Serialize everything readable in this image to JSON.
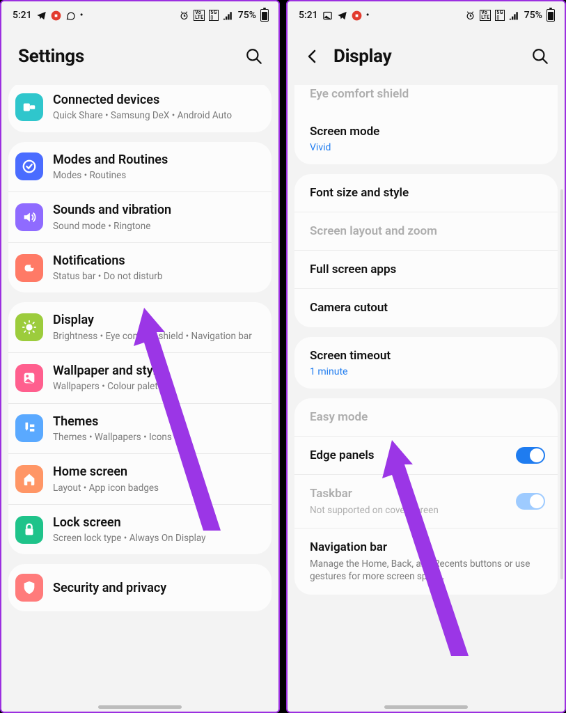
{
  "status": {
    "time": "5:21",
    "battery": "75%"
  },
  "left": {
    "title": "Settings",
    "items": [
      {
        "icon": "connected",
        "color": "#2fc6cc",
        "title": "Connected devices",
        "sub": "Quick Share  •  Samsung DeX  •  Android Auto"
      },
      {
        "icon": "modes",
        "color": "#4a6cff",
        "title": "Modes and Routines",
        "sub": "Modes  •  Routines"
      },
      {
        "icon": "sound",
        "color": "#8f6bff",
        "title": "Sounds and vibration",
        "sub": "Sound mode  •  Ringtone"
      },
      {
        "icon": "notif",
        "color": "#ff7a66",
        "title": "Notifications",
        "sub": "Status bar  •  Do not disturb"
      },
      {
        "icon": "display",
        "color": "#9ccc3c",
        "title": "Display",
        "sub": "Brightness  •  Eye comfort shield  •  Navigation bar"
      },
      {
        "icon": "wall",
        "color": "#ff5f8e",
        "title": "Wallpaper and style",
        "sub": "Wallpapers  •  Colour palette"
      },
      {
        "icon": "themes",
        "color": "#5aa9ff",
        "title": "Themes",
        "sub": "Themes  •  Wallpapers  •  Icons"
      },
      {
        "icon": "home",
        "color": "#ff9666",
        "title": "Home screen",
        "sub": "Layout  •  App icon badges"
      },
      {
        "icon": "lock",
        "color": "#1fc38a",
        "title": "Lock screen",
        "sub": "Screen lock type  •  Always On Display"
      },
      {
        "icon": "sec",
        "color": "#ff7b7b",
        "title": "Security and privacy",
        "sub": ""
      }
    ]
  },
  "right": {
    "title": "Display",
    "partial_top": "Eye comfort shield",
    "groups": [
      [
        {
          "title": "Screen mode",
          "value": "Vivid",
          "interactable": true
        }
      ],
      [
        {
          "title": "Font size and style",
          "interactable": true
        },
        {
          "title": "Screen layout and zoom",
          "interactable": true,
          "disabled": true
        },
        {
          "title": "Full screen apps",
          "interactable": true
        },
        {
          "title": "Camera cutout",
          "interactable": true
        }
      ],
      [
        {
          "title": "Screen timeout",
          "value": "1 minute",
          "interactable": true
        }
      ],
      [
        {
          "title": "Easy mode",
          "interactable": true,
          "disabled": true
        },
        {
          "title": "Edge panels",
          "interactable": true,
          "toggle": "on"
        },
        {
          "title": "Taskbar",
          "sub": "Not supported on cover screen",
          "interactable": false,
          "disabled": true,
          "toggle": "on-dis"
        },
        {
          "title": "Navigation bar",
          "sub": "Manage the Home, Back, and Recents buttons or use gestures for more screen space.",
          "interactable": true
        }
      ]
    ]
  }
}
